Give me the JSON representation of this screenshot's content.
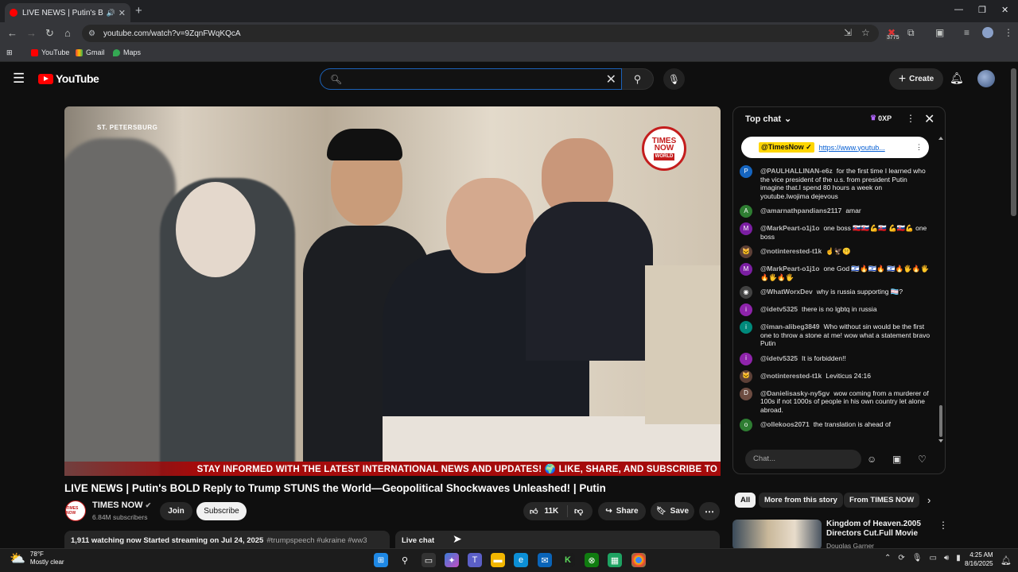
{
  "browser": {
    "tab_title": "LIVE NEWS | Putin's BOLD R",
    "url": "youtube.com/watch?v=9ZqnFWqKQcA",
    "extension_badge": "3775",
    "bookmarks": [
      "YouTube",
      "Gmail",
      "Maps"
    ]
  },
  "header": {
    "logo_text": "YouTube",
    "search_value": "",
    "create_label": "Create"
  },
  "video": {
    "location_overlay": "ST. PETERSBURG",
    "logo_lines": [
      "TIMES",
      "NOW"
    ],
    "logo_sub": "WORLD",
    "ticker": "STAY INFORMED WITH THE LATEST INTERNATIONAL NEWS AND UPDATES! 🌍 LIKE, SHARE, AND SUBSCRIBE TO",
    "title": "LIVE NEWS | Putin's BOLD Reply to Trump STUNS the World—Geopolitical Shockwaves Unleashed! | Putin"
  },
  "channel": {
    "name": "TIMES NOW",
    "subscribers": "6.84M subscribers",
    "join_label": "Join",
    "subscribe_label": "Subscribe",
    "avatar_text": "TIMES NOW"
  },
  "actions": {
    "likes": "11K",
    "share_label": "Share",
    "save_label": "Save"
  },
  "description": {
    "stats": "1,911 watching now  Started streaming on Jul 24, 2025",
    "tags": "#trumpspeech #ukraine #ww3",
    "live_chat_label": "Live chat"
  },
  "chat": {
    "mode": "Top chat",
    "xp": "0XP",
    "pinned_author": "@TimesNow ✓",
    "pinned_link": "https://www.youtub...",
    "input_placeholder": "Chat...",
    "messages": [
      {
        "initial": "P",
        "color": "#1565c0",
        "author": "@PAULHALLINAN-e6z",
        "text": "for the first time I learned who the vice president of the u.s. from president Putin imagine that.I spend 80 hours a week on youtube.Iwojima dejevous"
      },
      {
        "initial": "A",
        "color": "#2e7d32",
        "author": "@amarnathpandians2117",
        "text": "amar"
      },
      {
        "initial": "M",
        "color": "#7b1fa2",
        "author": "@MarkPeart-o1j1o",
        "text": "one boss 🇸🇰🇸🇰💪🇸🇰 💪🇸🇰💪 one boss"
      },
      {
        "initial": "🐱",
        "color": "#5d4037",
        "author": "@notinterested-t1k",
        "text": "☝️🦅🤫"
      },
      {
        "initial": "M",
        "color": "#7b1fa2",
        "author": "@MarkPeart-o1j1o",
        "text": "one God 🇮🇱🔥🇮🇱🔥 🇮🇱🔥🖐️🔥🖐️🔥🖐️🔥🖐️"
      },
      {
        "initial": "◉",
        "color": "#424242",
        "author": "@WhatWorxDev",
        "text": "why is russia supporting 🏳️‍⚧️?"
      },
      {
        "initial": "i",
        "color": "#8e24aa",
        "author": "@idetv5325",
        "text": "there is no lgbtq in russia"
      },
      {
        "initial": "i",
        "color": "#00897b",
        "author": "@iman-alibeg3849",
        "text": "Who without sin would be the first one to throw a stone at me! wow what a statement bravo Putin"
      },
      {
        "initial": "i",
        "color": "#8e24aa",
        "author": "@idetv5325",
        "text": "It is forbidden!!"
      },
      {
        "initial": "🐱",
        "color": "#5d4037",
        "author": "@notinterested-t1k",
        "text": "Leviticus 24:16"
      },
      {
        "initial": "D",
        "color": "#6d4c41",
        "author": "@Danielisasky-ny5gv",
        "text": "wow coming from a murderer of 100s if not 1000s of people in his own country let alone abroad."
      },
      {
        "initial": "o",
        "color": "#2e7d32",
        "author": "@ollekoos2071",
        "text": "the translation is ahead of"
      }
    ]
  },
  "chips": [
    "All",
    "More from this story",
    "From TIMES NOW"
  ],
  "recommendation": {
    "title": "Kingdom of Heaven.2005 Directors Cut.Full Movie",
    "channel": "Douglas Garner"
  },
  "taskbar": {
    "temperature": "78°F",
    "condition": "Mostly clear",
    "time": "4:25 AM",
    "date": "8/16/2025"
  },
  "colors": {
    "accent": "#ff0000",
    "search_focus": "#1c62b9",
    "ticker": "#a50b0b",
    "pinned_badge": "#ffd600"
  }
}
